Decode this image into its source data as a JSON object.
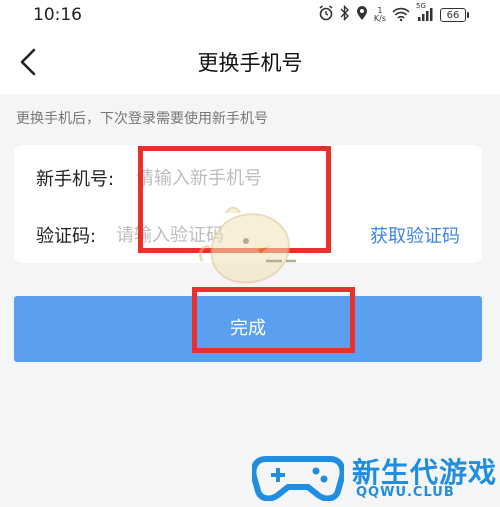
{
  "status_bar": {
    "time": "10:16",
    "speed_value": "1",
    "speed_unit": "K/s",
    "network": "5G",
    "battery": "66"
  },
  "header": {
    "title": "更换手机号"
  },
  "hint": "更换手机后，下次登录需要使用新手机号",
  "form": {
    "phone_label": "新手机号:",
    "phone_placeholder": "请输入新手机号",
    "code_label": "验证码:",
    "code_placeholder": "请输入验证码",
    "get_code_label": "获取验证码"
  },
  "done_label": "完成",
  "watermark": {
    "title": "新生代游戏",
    "subtitle": "QQWU.CLUB"
  },
  "colors": {
    "accent": "#3d86e8",
    "button": "#5b9ff0",
    "annotation": "#e8312a",
    "watermark": "#1f8de0"
  }
}
